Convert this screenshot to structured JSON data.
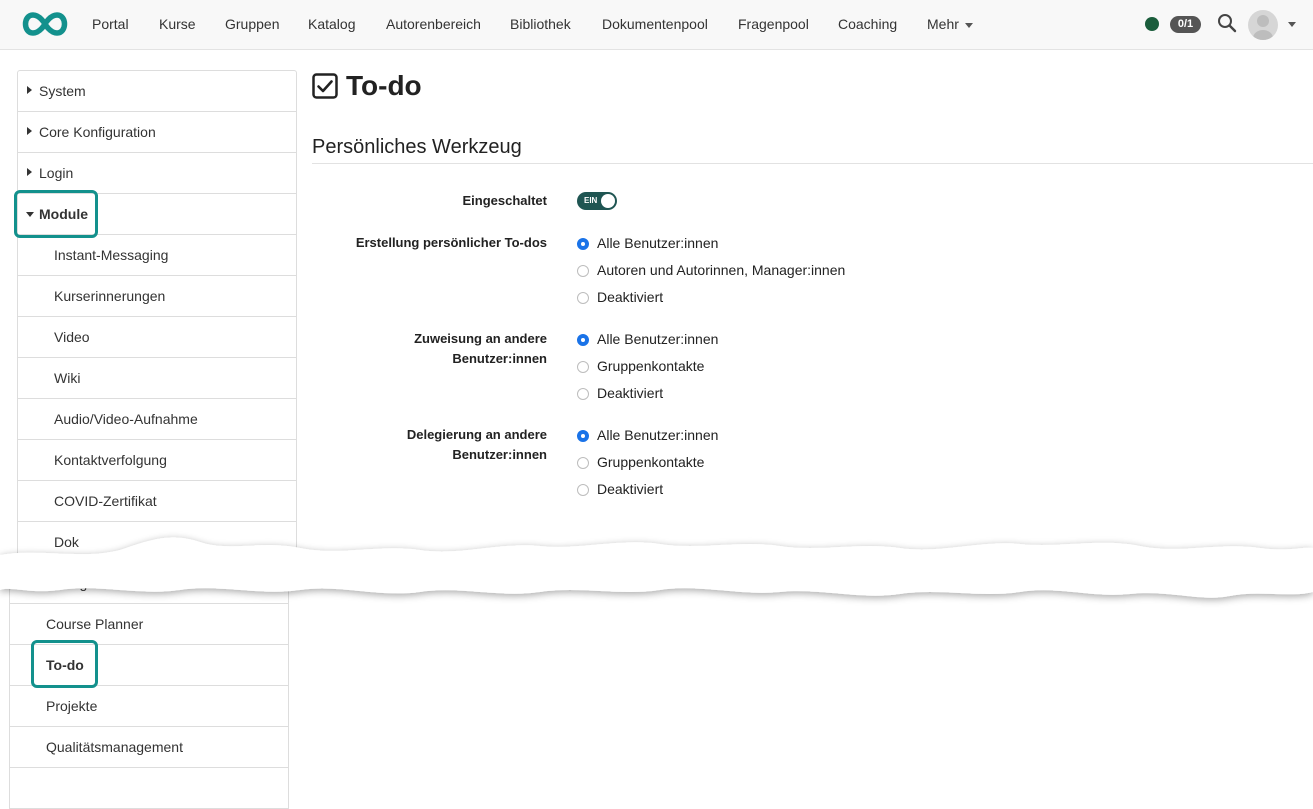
{
  "nav": {
    "items": [
      "Portal",
      "Kurse",
      "Gruppen",
      "Katalog",
      "Autorenbereich",
      "Bibliothek",
      "Dokumentenpool",
      "Fragenpool",
      "Coaching"
    ],
    "more_label": "Mehr",
    "badge": "0/1",
    "colors": {
      "brand": "#13918d",
      "status": "#1a5d3c"
    }
  },
  "sidebar": {
    "items": [
      {
        "label": "System",
        "expandable": true
      },
      {
        "label": "Core Konfiguration",
        "expandable": true
      },
      {
        "label": "Login",
        "expandable": true
      },
      {
        "label": "Module",
        "expandable": true,
        "expanded": true,
        "highlighted": true
      }
    ],
    "sub_items": [
      "Instant-Messaging",
      "Kurserinnerungen",
      "Video",
      "Wiki",
      "Audio/Video-Aufnahme",
      "Kontaktverfolgung",
      "COVID-Zertifikat",
      "Dok"
    ],
    "lower_items": [
      {
        "label": "Anfrage Konta"
      },
      {
        "label": "Course Planner"
      },
      {
        "label": "To-do",
        "active": true,
        "highlighted": true
      },
      {
        "label": "Projekte"
      },
      {
        "label": "Qualitätsmanagement"
      }
    ]
  },
  "main": {
    "title": "To-do",
    "section_title": "Persönliches Werkzeug",
    "enabled_label": "Eingeschaltet",
    "toggle_text": "EIN",
    "groups": [
      {
        "label": "Erstellung persönlicher To-dos",
        "options": [
          "Alle Benutzer:innen",
          "Autoren und Autorinnen, Manager:innen",
          "Deaktiviert"
        ],
        "selected": 0
      },
      {
        "label_line1": "Zuweisung an andere",
        "label_line2": "Benutzer:innen",
        "options": [
          "Alle Benutzer:innen",
          "Gruppenkontakte",
          "Deaktiviert"
        ],
        "selected": 0
      },
      {
        "label_line1": "Delegierung an andere",
        "label_line2": "Benutzer:innen",
        "options": [
          "Alle Benutzer:innen",
          "Gruppenkontakte",
          "Deaktiviert"
        ],
        "selected": 0
      }
    ]
  }
}
